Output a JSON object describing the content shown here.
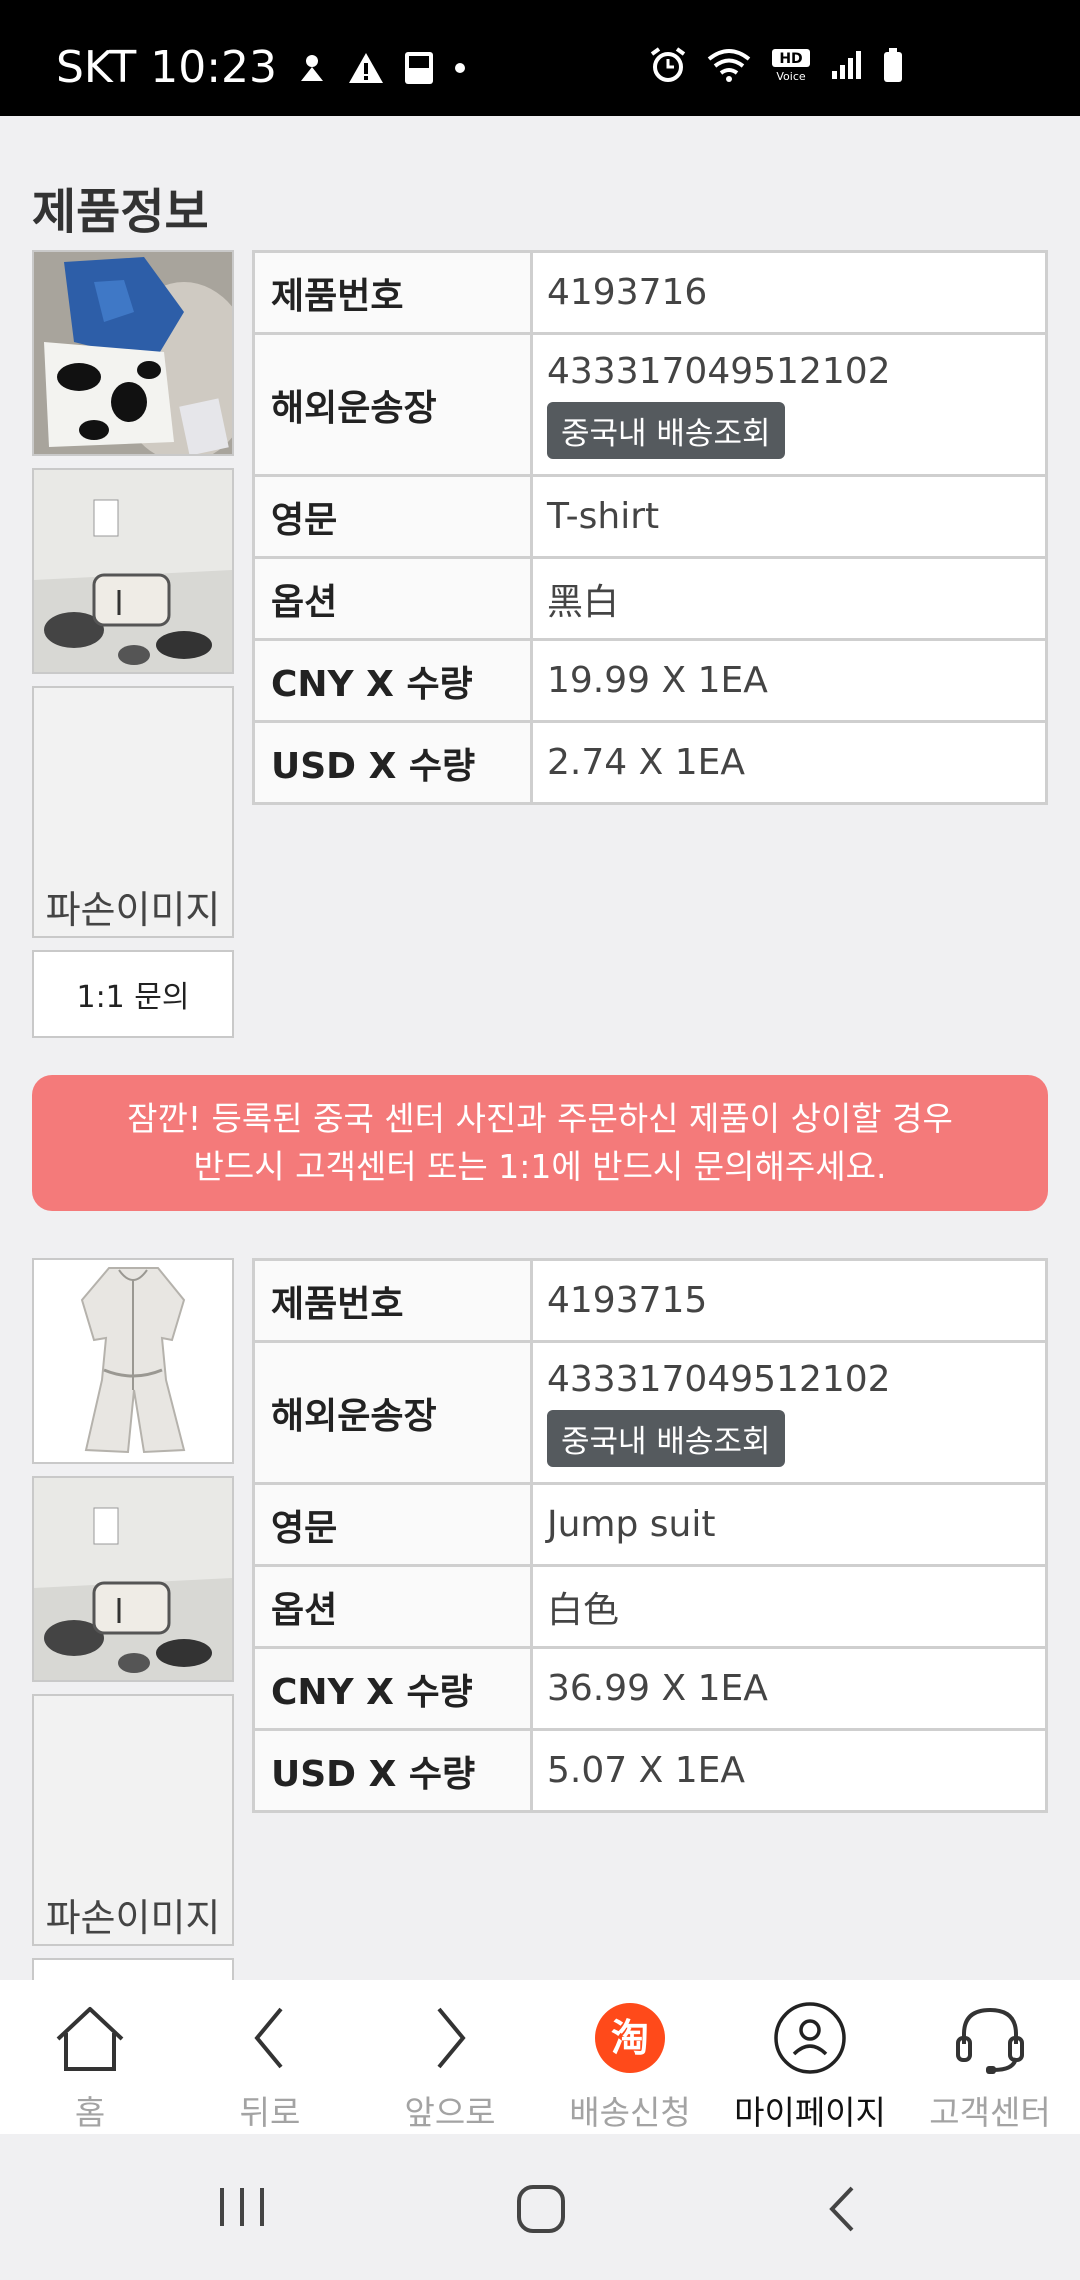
{
  "status_bar": {
    "carrier_time": "SKT 10:23"
  },
  "page_title": "제품정보",
  "products": [
    {
      "rows": {
        "product_number": {
          "label": "제품번호",
          "value": "4193716"
        },
        "tracking": {
          "label": "해외운송장",
          "value": "433317049512102",
          "button": "중국내 배송조회"
        },
        "english": {
          "label": "영문",
          "value": "T-shirt"
        },
        "option": {
          "label": "옵션",
          "value": "黑白"
        },
        "cny": {
          "label": "CNY X 수량",
          "value": "19.99 X 1EA"
        },
        "usd": {
          "label": "USD X 수량",
          "value": "2.74 X 1EA"
        }
      },
      "damage_label": "파손이미지",
      "inquiry_label": "1:1 문의"
    },
    {
      "rows": {
        "product_number": {
          "label": "제품번호",
          "value": "4193715"
        },
        "tracking": {
          "label": "해외운송장",
          "value": "433317049512102",
          "button": "중국내 배송조회"
        },
        "english": {
          "label": "영문",
          "value": "Jump suit"
        },
        "option": {
          "label": "옵션",
          "value": "白色"
        },
        "cny": {
          "label": "CNY X 수량",
          "value": "36.99 X 1EA"
        },
        "usd": {
          "label": "USD X 수량",
          "value": "5.07 X 1EA"
        }
      },
      "damage_label": "파손이미지"
    }
  ],
  "alert": {
    "line1": "잠깐! 등록된 중국 센터 사진과 주문하신 제품이 상이할 경우",
    "line2": "반드시 고객센터 또는 1:1에 반드시 문의해주세요."
  },
  "bottom_nav": [
    {
      "label": "홈",
      "icon": "home-icon"
    },
    {
      "label": "뒤로",
      "icon": "chevron-left-icon"
    },
    {
      "label": "앞으로",
      "icon": "chevron-right-icon"
    },
    {
      "label": "배송신청",
      "icon": "taobao-icon",
      "badge_char": "淘"
    },
    {
      "label": "마이페이지",
      "icon": "user-icon",
      "active": true
    },
    {
      "label": "고객센터",
      "icon": "headset-icon"
    }
  ],
  "colors": {
    "alert": "#f47a7a",
    "accent": "#ff4a1a",
    "track_button": "#555a5e"
  }
}
